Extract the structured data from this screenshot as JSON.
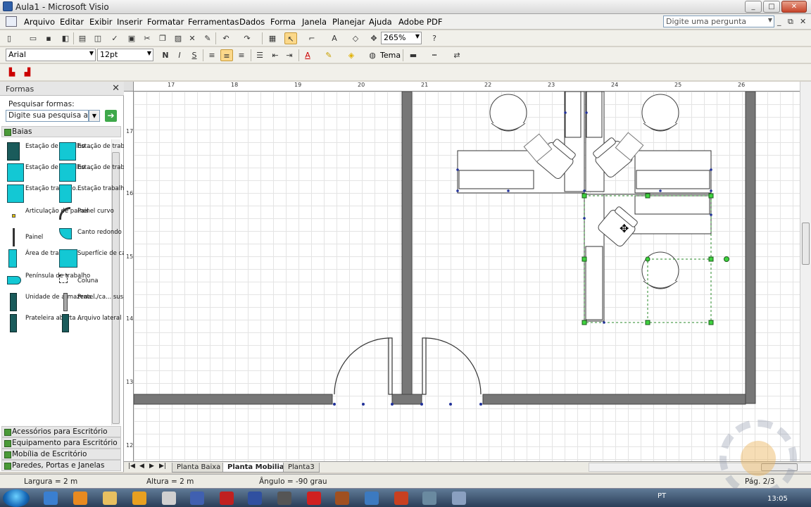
{
  "window": {
    "title": "Aula1 - Microsoft Visio"
  },
  "menubar": {
    "items": [
      "Arquivo",
      "Editar",
      "Exibir",
      "Inserir",
      "Formatar",
      "Ferramentas",
      "Dados",
      "Forma",
      "Janela",
      "Planejar",
      "Ajuda",
      "Adobe PDF"
    ],
    "ask_placeholder": "Digite uma pergunta"
  },
  "toolbar": {
    "zoom": "265%",
    "font": "Arial",
    "font_size": "12pt",
    "bold": "N",
    "italic": "I",
    "underline": "S",
    "theme": "Tema",
    "font_color_label": "A"
  },
  "shapes_panel": {
    "title": "Formas",
    "search_label": "Pesquisar formas:",
    "search_placeholder": "Digite sua pesquisa aqui",
    "stencil": "Baias",
    "items": [
      "Estação de trabalho ...",
      "Estação de trabalho ...",
      "Estação de trabalho ...",
      "Estação de trabalho ...",
      "Estação trabalho...",
      "Estação trabalho...",
      "Articulação de painel",
      "Painel curvo",
      "Painel",
      "Canto redondo",
      "Área de trabalho",
      "Superfície de canto",
      "Península de trabalho",
      "Coluna",
      "Unidade de armazena...",
      "Pratel./ca... susp. p/ c...",
      "Prateleira aberta ...",
      "Arquivo lateral ..."
    ],
    "other_stencils": [
      "Acessórios para Escritório",
      "Equipamento para Escritório",
      "Mobília de Escritório",
      "Paredes, Portas e Janelas"
    ]
  },
  "ruler": {
    "h_ticks": [
      "17",
      "18",
      "19",
      "20",
      "21",
      "22",
      "23",
      "24",
      "25",
      "26"
    ],
    "v_ticks": [
      "17",
      "16",
      "15",
      "14",
      "13",
      "12"
    ]
  },
  "page_tabs": [
    {
      "label": "Planta Baixa",
      "active": false
    },
    {
      "label": "Planta Mobilia",
      "active": true
    },
    {
      "label": "Planta3",
      "active": false
    }
  ],
  "status": {
    "width": "Largura = 2 m",
    "height": "Altura = 2 m",
    "angle": "Ângulo = -90 grau",
    "page": "Pág. 2/3"
  },
  "taskbar": {
    "lang": "PT",
    "time": "13:05"
  }
}
